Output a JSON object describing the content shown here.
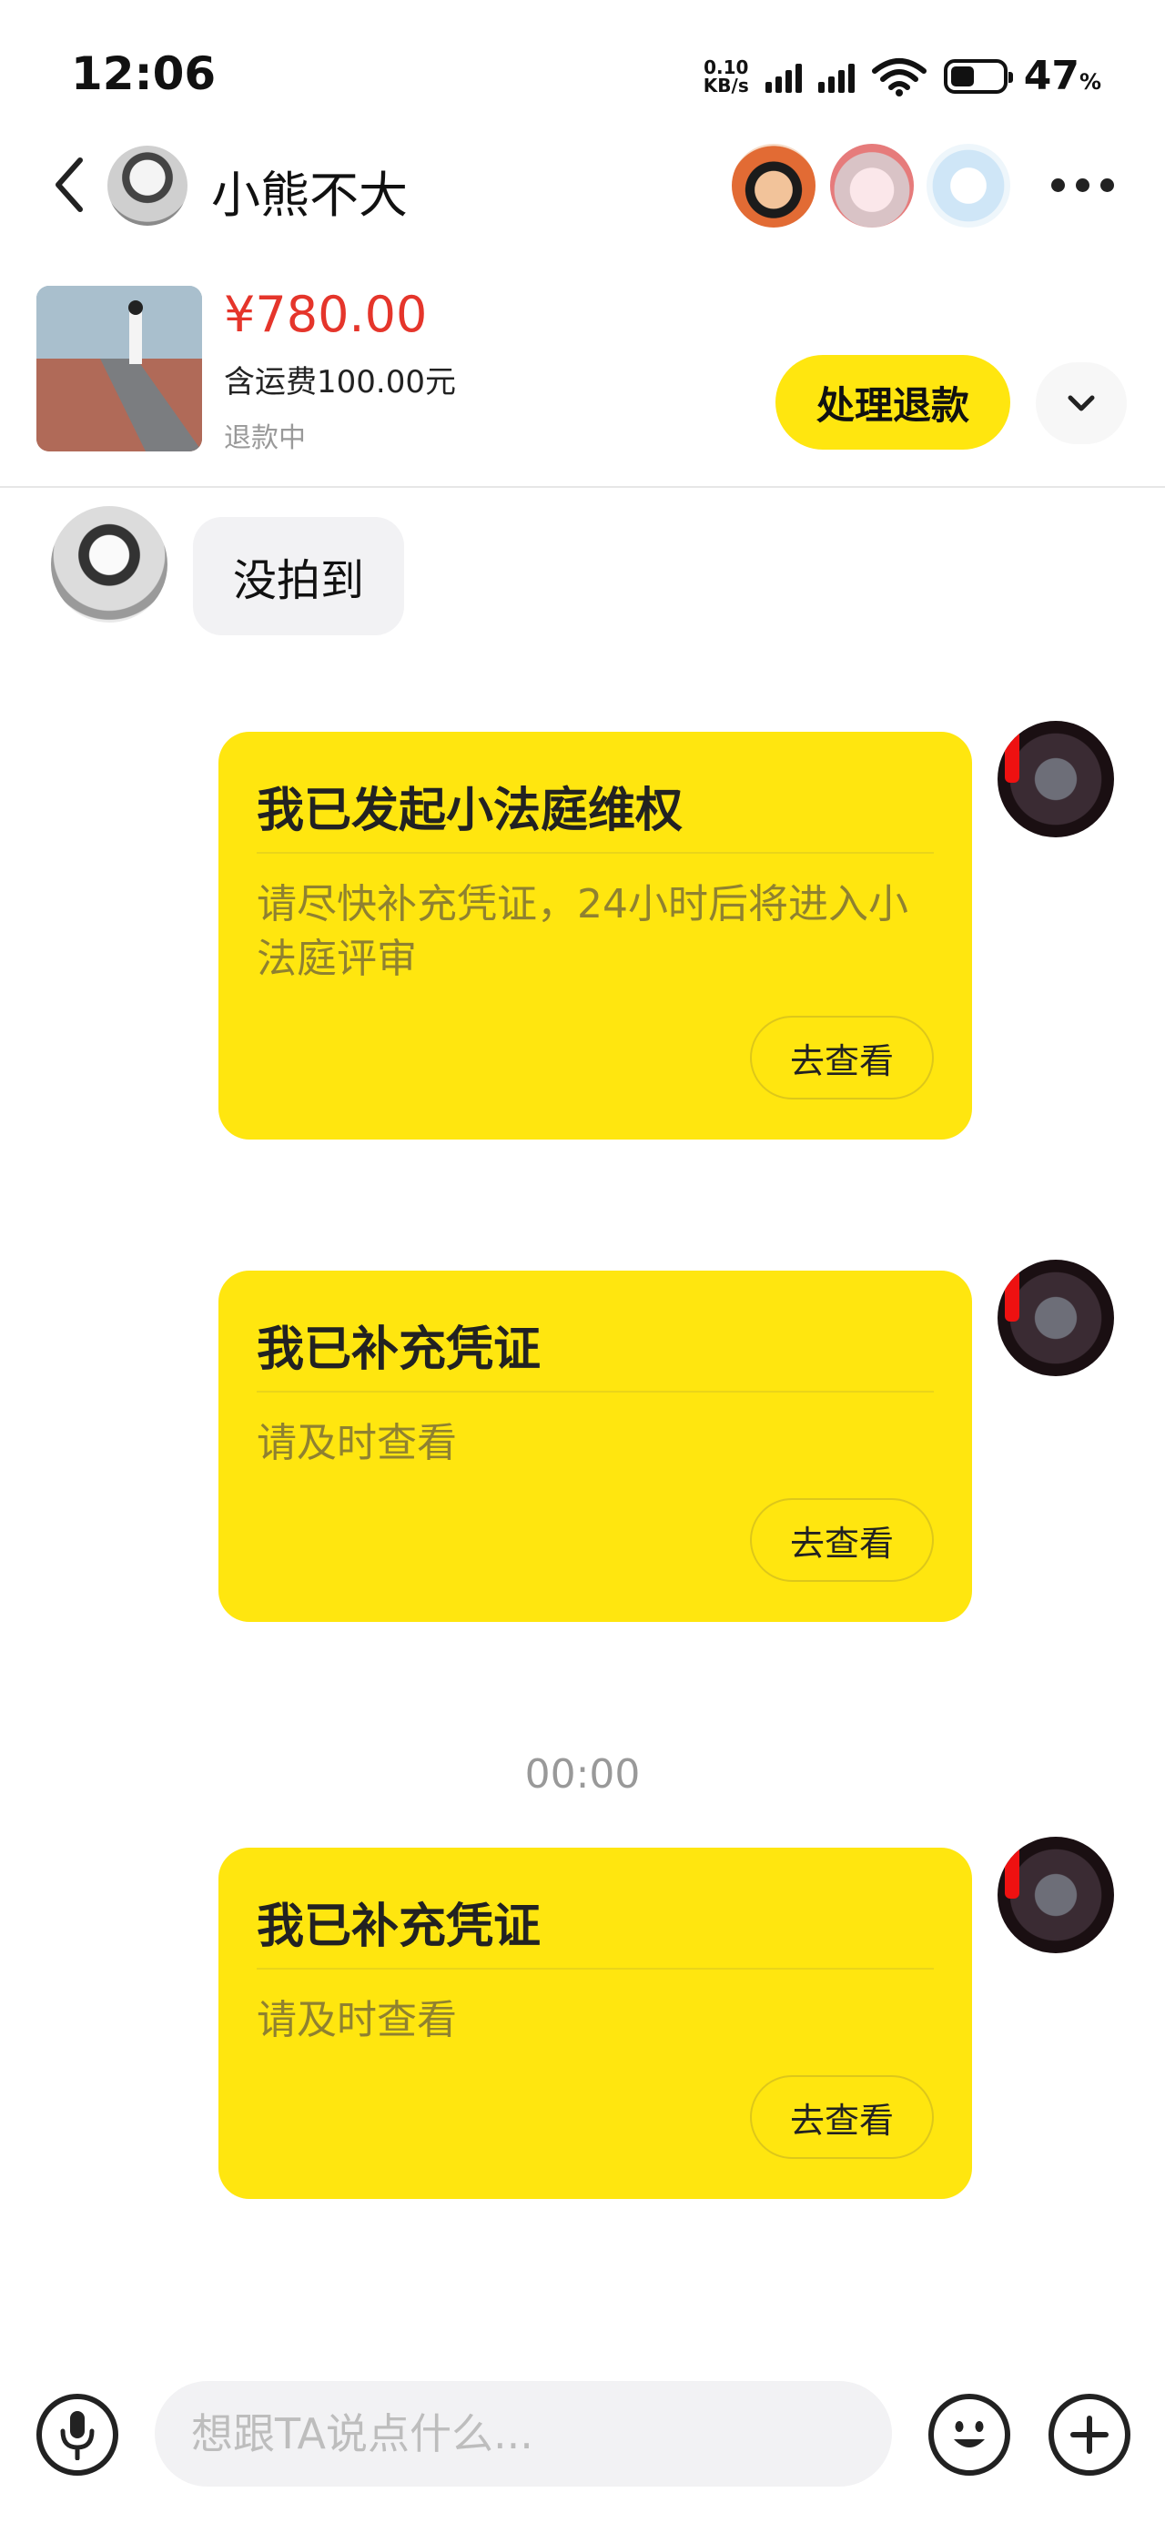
{
  "status_bar": {
    "time": "12:06",
    "net_speed_value": "0.10",
    "net_speed_unit": "KB/s",
    "battery_percent": "47",
    "battery_unit": "%"
  },
  "header": {
    "title": "小熊不大",
    "icons": [
      "back-arrow-icon",
      "more-dots-icon"
    ]
  },
  "order": {
    "price": "¥780.00",
    "shipping": "含运费100.00元",
    "status": "退款中",
    "refund_button": "处理退款"
  },
  "messages": {
    "incoming_text": "没拍到",
    "card1": {
      "title": "我已发起小法庭维权",
      "desc": "请尽快补充凭证，24小时后将进入小法庭评审",
      "button": "去查看"
    },
    "card2": {
      "title": "我已补充凭证",
      "desc": "请及时查看",
      "button": "去查看"
    },
    "time_separator": "00:00",
    "card3": {
      "title": "我已补充凭证",
      "desc": "请及时查看",
      "button": "去查看"
    }
  },
  "input_bar": {
    "placeholder": "想跟TA说点什么..."
  },
  "colors": {
    "accent_yellow": "#ffe60f",
    "price_red": "#e5352b"
  }
}
